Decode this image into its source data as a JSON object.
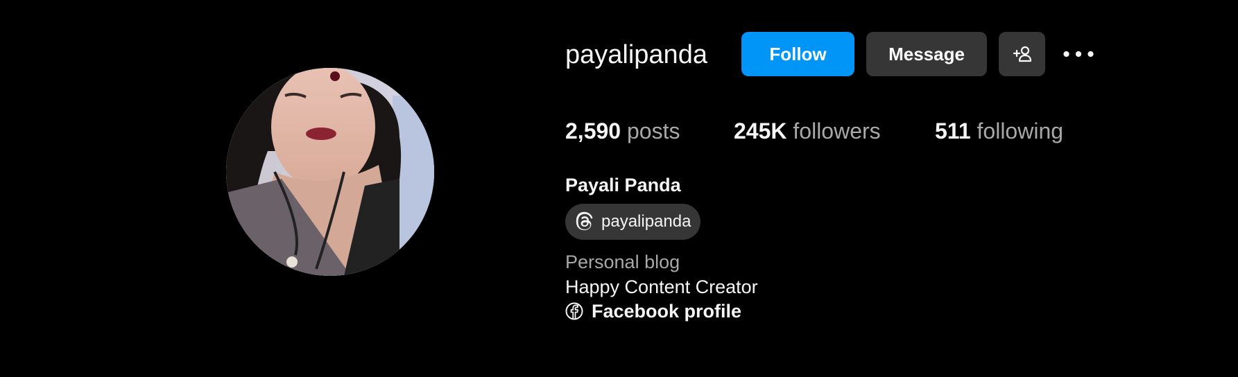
{
  "profile": {
    "username": "payalipanda",
    "full_name": "Payali Panda",
    "threads_handle": "payalipanda",
    "category": "Personal blog",
    "bio": "Happy Content Creator",
    "link_label": "Facebook profile"
  },
  "actions": {
    "follow_label": "Follow",
    "message_label": "Message",
    "suggest_icon": "add-person-icon",
    "more_icon": "more-options-icon"
  },
  "stats": {
    "posts_count": "2,590",
    "posts_label": "posts",
    "followers_count": "245K",
    "followers_label": "followers",
    "following_count": "511",
    "following_label": "following"
  },
  "colors": {
    "background": "#000000",
    "follow_button": "#0095f6",
    "secondary_button": "#363636",
    "muted_text": "#a8a8a8"
  }
}
